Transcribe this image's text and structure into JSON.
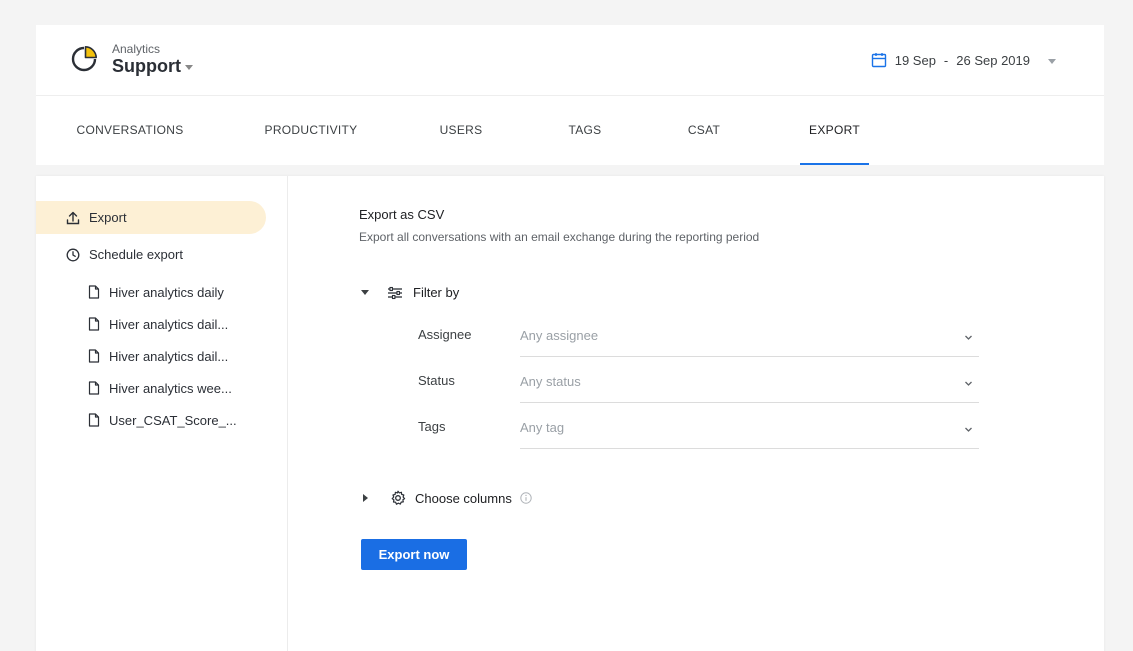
{
  "app": {
    "subtitle": "Analytics",
    "title": "Support"
  },
  "date_range": {
    "start": "19 Sep",
    "separator": "-",
    "end": "26 Sep 2019"
  },
  "tabs": [
    {
      "label": "CONVERSATIONS"
    },
    {
      "label": "PRODUCTIVITY"
    },
    {
      "label": "USERS"
    },
    {
      "label": "TAGS"
    },
    {
      "label": "CSAT"
    },
    {
      "label": "EXPORT",
      "active": true
    }
  ],
  "sidebar": {
    "export_label": "Export",
    "schedule_label": "Schedule export",
    "scheduled_items": [
      {
        "label": "Hiver analytics daily"
      },
      {
        "label": "Hiver analytics dail..."
      },
      {
        "label": "Hiver analytics dail..."
      },
      {
        "label": "Hiver analytics wee..."
      },
      {
        "label": "User_CSAT_Score_..."
      }
    ]
  },
  "main": {
    "title": "Export as CSV",
    "description": "Export all conversations with an email exchange during the reporting period",
    "filter": {
      "label": "Filter by",
      "fields": [
        {
          "label": "Assignee",
          "placeholder": "Any assignee"
        },
        {
          "label": "Status",
          "placeholder": "Any status"
        },
        {
          "label": "Tags",
          "placeholder": "Any tag"
        }
      ]
    },
    "columns_label": "Choose columns",
    "export_button": "Export now"
  },
  "colors": {
    "accent": "#1a6ee4",
    "active_tab_underline": "#1a73e8",
    "sidebar_active_bg": "#fdf0d5",
    "logo_yellow": "#f4c20d"
  },
  "icons": {
    "logo": "pie-chart-icon",
    "date": "calendar-icon",
    "export": "upload-icon",
    "schedule": "clock-icon",
    "scheduled_item": "file-icon",
    "filter": "sliders-icon",
    "columns": "gear-icon",
    "info": "info-icon"
  }
}
